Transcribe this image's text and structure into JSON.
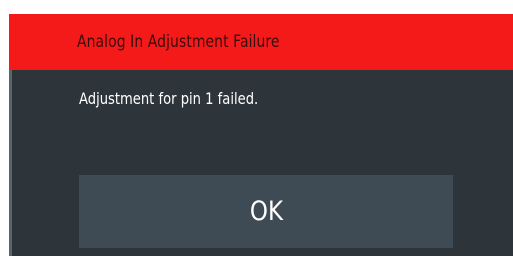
{
  "dialog": {
    "title": "Analog In Adjustment Failure",
    "message": "Adjustment for pin 1 failed.",
    "ok_label": "OK"
  },
  "colors": {
    "title_bar": "#f51a1a",
    "background": "#2d353b",
    "button": "#3f4b54",
    "text": "#ffffff"
  }
}
